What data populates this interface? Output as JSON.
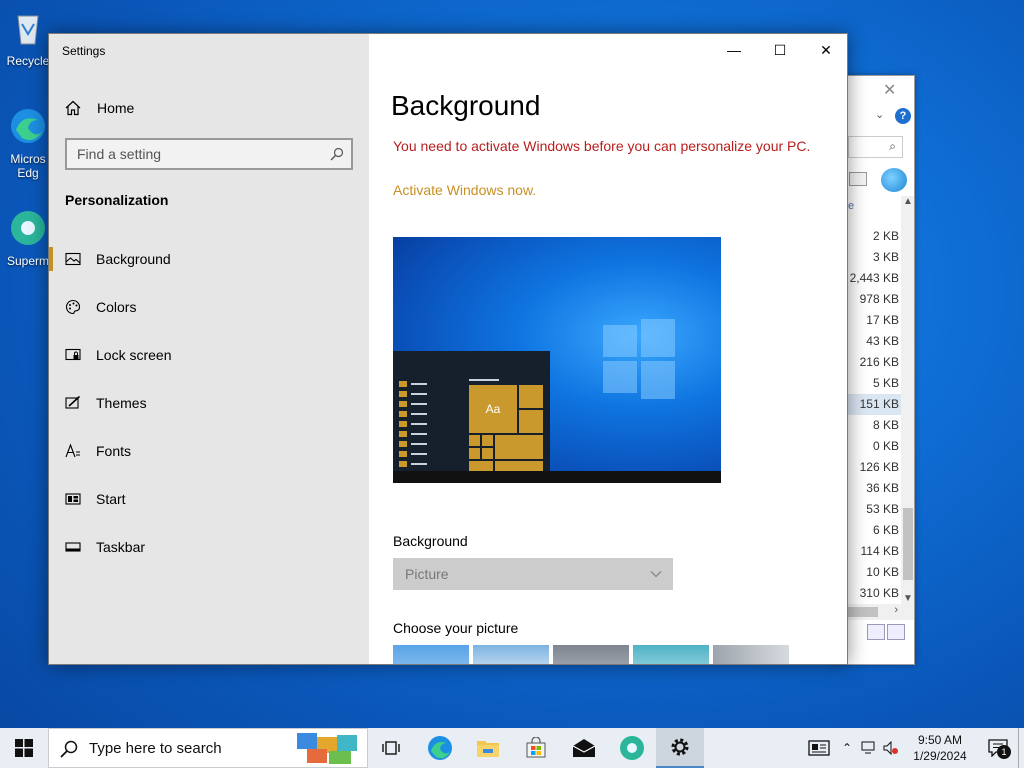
{
  "desktop": {
    "icons": [
      {
        "label": "Recycle"
      },
      {
        "label": "Micros Edg"
      },
      {
        "label": "Superm"
      }
    ]
  },
  "explorer": {
    "close_glyph": "✕",
    "header_partial": "e",
    "sizes": [
      "2 KB",
      "3 KB",
      "2,443 KB",
      "978 KB",
      "17 KB",
      "43 KB",
      "216 KB",
      "5 KB",
      "151 KB",
      "8 KB",
      "0 KB",
      "126 KB",
      "36 KB",
      "53 KB",
      "6 KB",
      "114 KB",
      "10 KB",
      "310 KB"
    ],
    "selected_index": 8
  },
  "settings": {
    "title": "Settings",
    "home_label": "Home",
    "search": {
      "placeholder": "Find a setting"
    },
    "section": "Personalization",
    "nav": [
      {
        "label": "Background",
        "icon": "picture-icon",
        "active": true
      },
      {
        "label": "Colors",
        "icon": "palette-icon"
      },
      {
        "label": "Lock screen",
        "icon": "lock-screen-icon"
      },
      {
        "label": "Themes",
        "icon": "themes-icon"
      },
      {
        "label": "Fonts",
        "icon": "fonts-icon"
      },
      {
        "label": "Start",
        "icon": "start-icon"
      },
      {
        "label": "Taskbar",
        "icon": "taskbar-icon"
      }
    ],
    "window_buttons": {
      "minimize": "—",
      "maximize": "☐",
      "close": "✕"
    },
    "page_title": "Background",
    "warning": "You need to activate Windows before you can personalize your PC.",
    "activate_link": "Activate Windows now.",
    "preview": {
      "tile_label": "Aa"
    },
    "background_label": "Background",
    "background_value": "Picture",
    "choose_label": "Choose your picture",
    "colors": {
      "accent": "#c88f23",
      "warning": "#b81e1e",
      "sidebar": "#e6e6e6"
    }
  },
  "taskbar": {
    "search_text": "Type here to search",
    "clock_time": "9:50 AM",
    "clock_date": "1/29/2024",
    "notification_count": "1"
  }
}
